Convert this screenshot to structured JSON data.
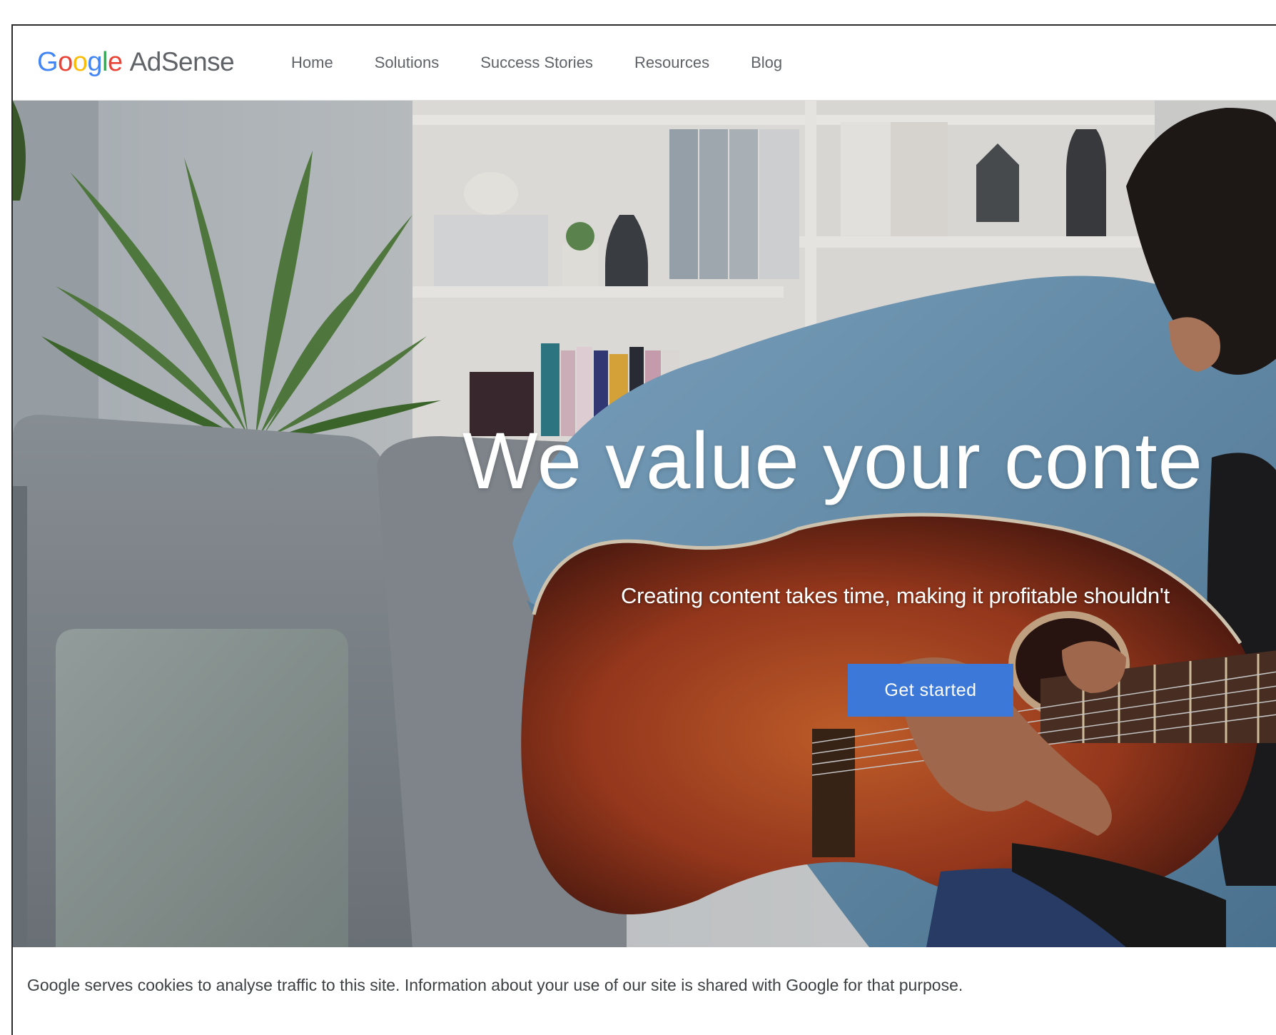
{
  "header": {
    "logo": {
      "google_letters": [
        "G",
        "o",
        "o",
        "g",
        "l",
        "e"
      ],
      "google_colors": [
        "#4285F4",
        "#EA4335",
        "#FBBC05",
        "#4285F4",
        "#34A853",
        "#EA4335"
      ],
      "product": "AdSense"
    },
    "nav": [
      {
        "label": "Home"
      },
      {
        "label": "Solutions"
      },
      {
        "label": "Success Stories"
      },
      {
        "label": "Resources"
      },
      {
        "label": "Blog"
      }
    ]
  },
  "hero": {
    "headline": "We value your conte",
    "subheadline": "Creating content takes time, making it profitable shouldn't",
    "cta_label": "Get started",
    "cta_color": "#3b78d8",
    "background_description_icon": "photo-man-playing-guitar-on-sofa"
  },
  "cookie_banner": {
    "text": "Google serves cookies to analyse traffic to this site. Information about your use of our site is shared with Google for that purpose."
  }
}
